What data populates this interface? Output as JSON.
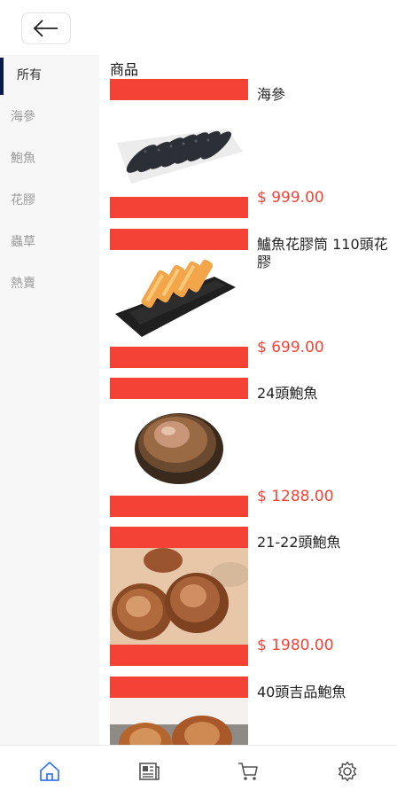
{
  "sidebar": {
    "items": [
      {
        "label": "所有",
        "active": true
      },
      {
        "label": "海參",
        "active": false
      },
      {
        "label": "鮑魚",
        "active": false
      },
      {
        "label": "花膠",
        "active": false
      },
      {
        "label": "蟲草",
        "active": false
      },
      {
        "label": "熱賣",
        "active": false
      }
    ]
  },
  "main": {
    "section_title": "商品",
    "products": [
      {
        "name": "海參",
        "price": "$ 999.00"
      },
      {
        "name": "鱸魚花膠筒 110頭花膠",
        "price": "$ 699.00"
      },
      {
        "name": "24頭鮑魚",
        "price": "$ 1288.00"
      },
      {
        "name": "21-22頭鮑魚",
        "price": "$ 1980.00"
      },
      {
        "name": "40頭吉品鮑魚",
        "price": ""
      }
    ]
  },
  "bottom_nav": {
    "items": [
      {
        "icon": "home-icon",
        "active": true
      },
      {
        "icon": "news-icon",
        "active": false
      },
      {
        "icon": "cart-icon",
        "active": false
      },
      {
        "icon": "settings-icon",
        "active": false
      }
    ]
  },
  "colors": {
    "accent": "#f44336",
    "active_nav": "#3b7bea",
    "sidebar_indicator": "#0b1a4a"
  }
}
